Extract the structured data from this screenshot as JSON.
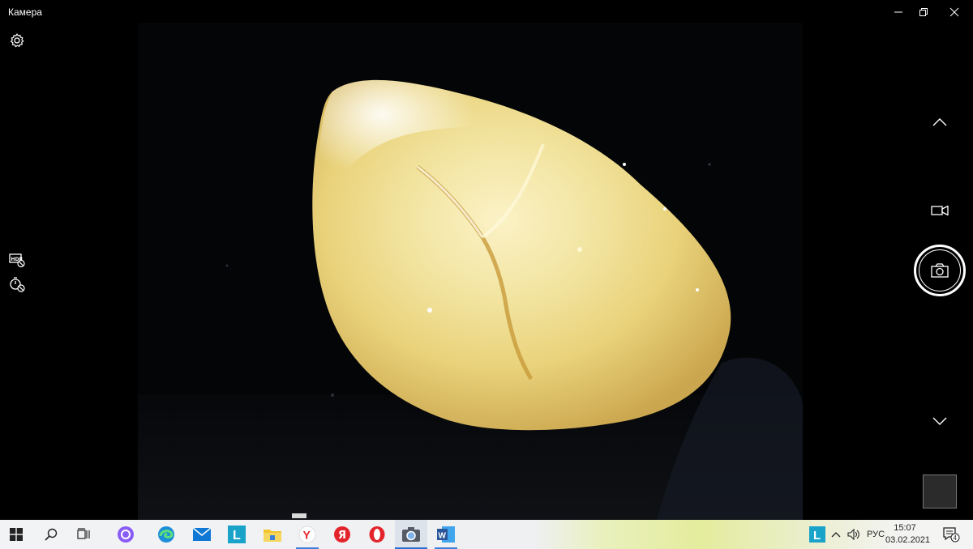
{
  "window": {
    "title": "Камера"
  },
  "taskbar": {
    "apps": [
      {
        "name": "start",
        "icon": "windows-logo-icon"
      },
      {
        "name": "search",
        "icon": "search-icon"
      },
      {
        "name": "task-view",
        "icon": "task-view-icon"
      },
      {
        "name": "alice",
        "icon": "alice-icon"
      },
      {
        "name": "edge",
        "icon": "edge-icon"
      },
      {
        "name": "mail",
        "icon": "mail-icon"
      },
      {
        "name": "lingvo",
        "icon": "l-app-icon",
        "letter": "L"
      },
      {
        "name": "explorer",
        "icon": "folder-icon"
      },
      {
        "name": "yandex-browser",
        "icon": "yandex-browser-icon",
        "letter": "Y"
      },
      {
        "name": "yandex",
        "icon": "yandex-icon",
        "letter": "Я"
      },
      {
        "name": "opera",
        "icon": "opera-icon"
      },
      {
        "name": "camera",
        "icon": "camera-app-icon"
      },
      {
        "name": "word",
        "icon": "word-icon",
        "letter": "W"
      }
    ],
    "tray": {
      "tray_app_letter": "L",
      "language": "РУС",
      "time": "15:07",
      "date": "03.02.2021",
      "notifications_count": "4"
    }
  },
  "colors": {
    "accent": "#2b6fd6",
    "alice": "#8a5cf6",
    "yandex_red": "#e3242b",
    "mail_blue": "#0f78d4",
    "word_blue": "#2b579a",
    "lingvo_teal": "#1aa3c9",
    "folder_yellow": "#f2c430"
  }
}
